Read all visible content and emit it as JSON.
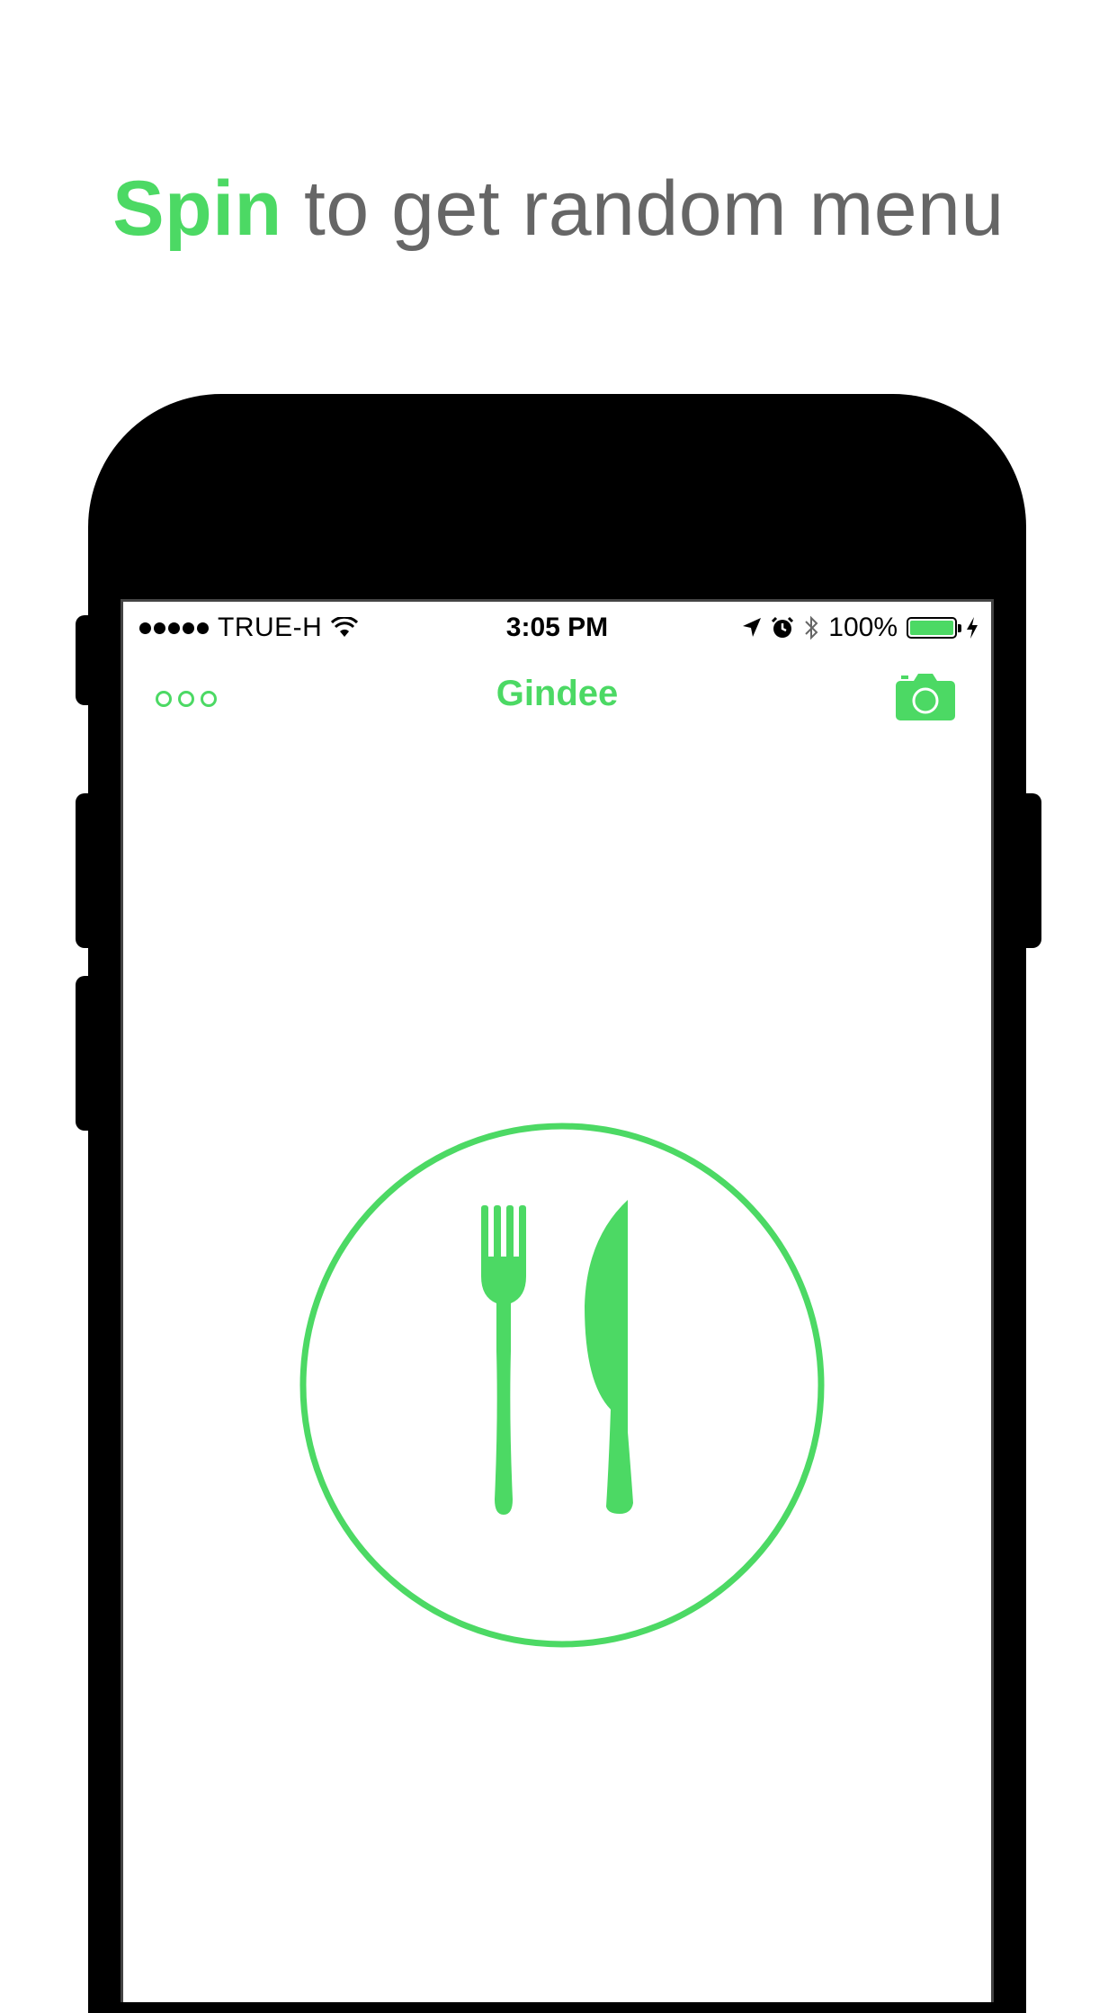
{
  "headline": {
    "accent": "Spin",
    "rest": " to get random menu"
  },
  "status_bar": {
    "carrier": "TRUE-H",
    "time": "3:05 PM",
    "battery_percent": "100%",
    "battery_level": 1.0
  },
  "nav": {
    "title": "Gindee",
    "more_icon": "more-dots-icon",
    "camera_icon": "camera-icon"
  },
  "main": {
    "plate_icon": "fork-knife-plate-icon"
  },
  "colors": {
    "accent": "#4cd964",
    "headline_text": "#666666",
    "phone_body": "#000000"
  }
}
